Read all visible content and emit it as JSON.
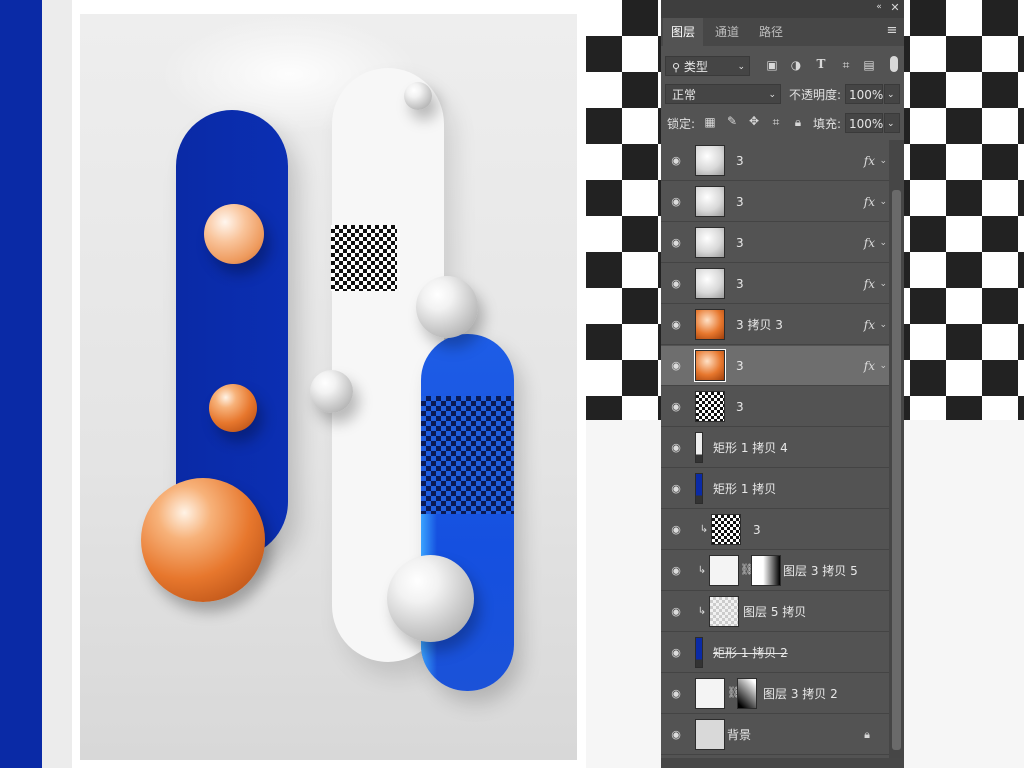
{
  "panel": {
    "tabs": [
      "图层",
      "通道",
      "路径"
    ],
    "filter": {
      "label": "类型"
    },
    "blend_mode": "正常",
    "opacity": {
      "label": "不透明度:",
      "value": "100%"
    },
    "lock": {
      "label": "锁定:"
    },
    "fill": {
      "label": "填充:",
      "value": "100%"
    },
    "layers": [
      {
        "name": "3",
        "type": "pearl",
        "fx": true
      },
      {
        "name": "3",
        "type": "pearl",
        "fx": true
      },
      {
        "name": "3",
        "type": "pearl",
        "fx": true
      },
      {
        "name": "3",
        "type": "pearl",
        "fx": true
      },
      {
        "name": "3 拷贝 3",
        "type": "orange",
        "fx": true
      },
      {
        "name": "3",
        "type": "orange",
        "fx": true,
        "selected": true
      },
      {
        "name": "3",
        "type": "checker",
        "fx": false
      },
      {
        "name": "矩形 1 拷贝 4",
        "type": "rect-white",
        "fx": false
      },
      {
        "name": "矩形 1 拷贝",
        "type": "rect-blue",
        "fx": false
      },
      {
        "name": "3",
        "type": "checker-clip",
        "fx": false
      },
      {
        "name": "图层 3 拷贝 5",
        "type": "mask-white-grad",
        "fx": false
      },
      {
        "name": "图层 5 拷贝",
        "type": "checker-clip2",
        "fx": false
      },
      {
        "name": "矩形 1 拷贝 2",
        "type": "rect-blue-strike",
        "fx": false
      },
      {
        "name": "图层 3 拷贝 2",
        "type": "mask-black-grad",
        "fx": false
      },
      {
        "name": "背景",
        "type": "background",
        "fx": false,
        "locked": true
      }
    ]
  },
  "icons": [
    "filter-pixel-icon",
    "filter-adjust-icon",
    "filter-type-icon",
    "filter-shape-icon",
    "filter-smart-icon"
  ],
  "colors": {
    "accent_blue": "#0a2aa6",
    "orange": "#e7772d",
    "panel_bg": "#535353"
  }
}
